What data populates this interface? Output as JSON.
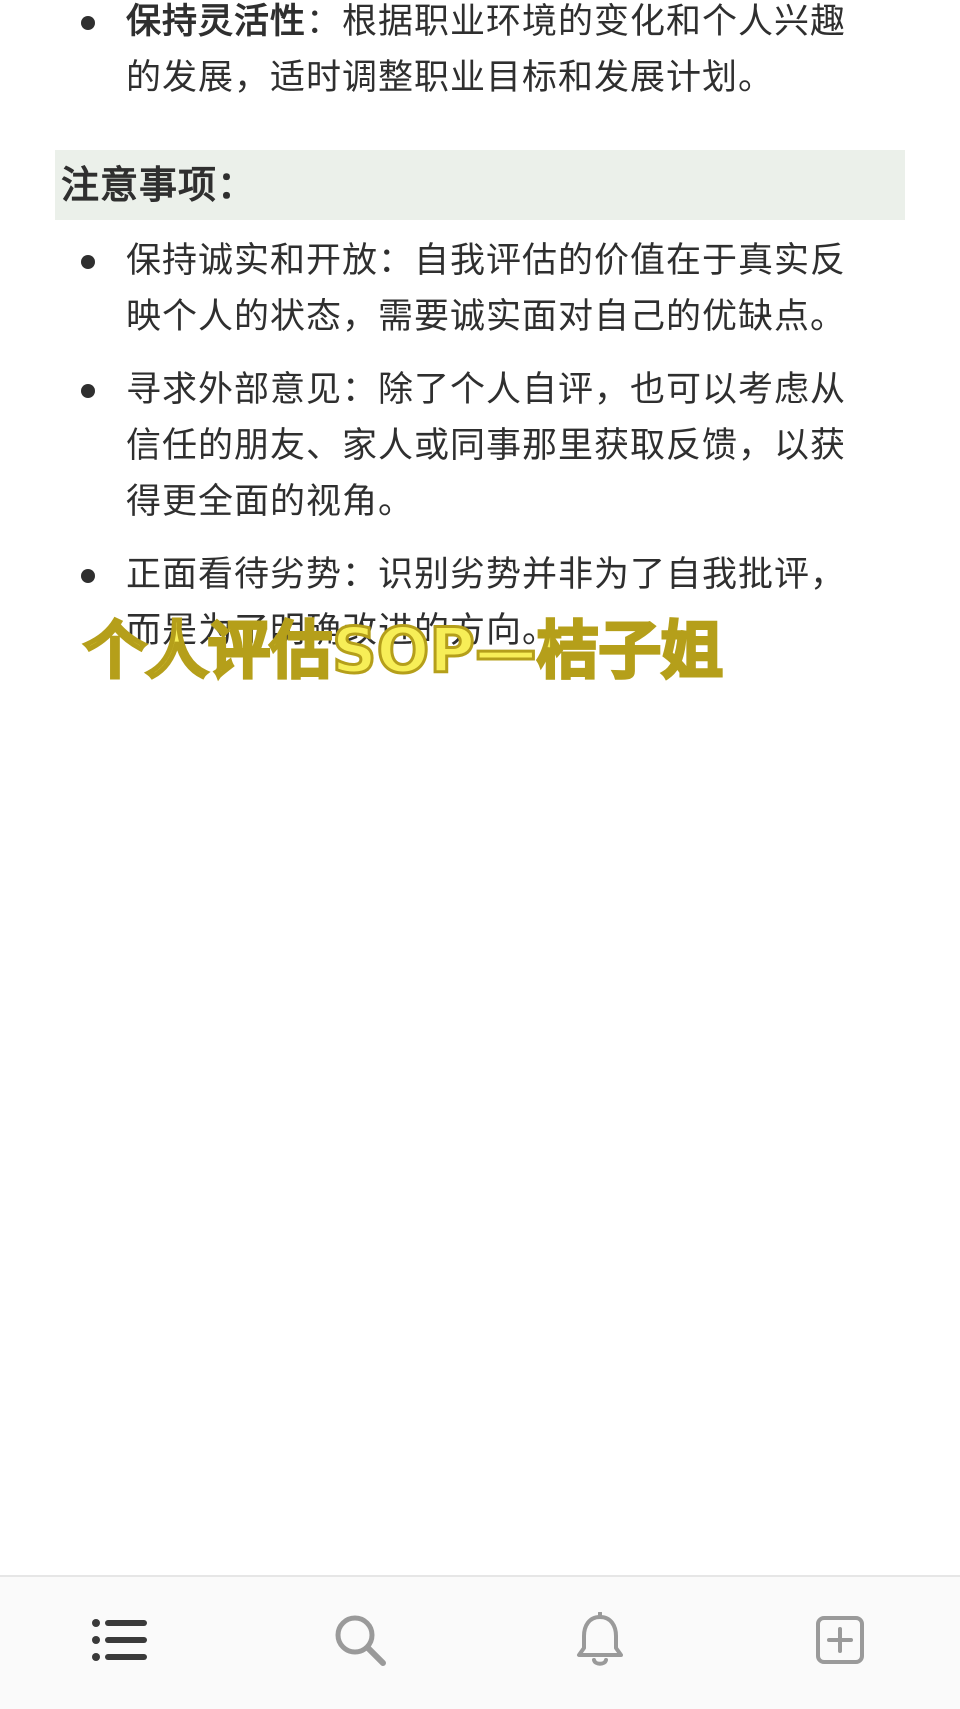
{
  "content": {
    "flexibility": {
      "term": "保持灵活性",
      "colon": "：",
      "line1_rest": "根据职业环境的变化和个人兴趣",
      "line2": "的发展，适时调整职业目标和发展计划。"
    },
    "section_title": "注意事项：",
    "items": [
      {
        "line1": "保持诚实和开放：自我评估的价值在于真实反",
        "line2": "映个人的状态，需要诚实面对自己的优缺点。"
      },
      {
        "line1": "寻求外部意见：除了个人自评，也可以考虑从",
        "line2": "信任的朋友、家人或同事那里获取反馈，以获",
        "line3": "得更全面的视角。"
      },
      {
        "line1": "正面看待劣势：识别劣势并非为了自我批评，",
        "line2": "而是为了明确改进的方向。"
      }
    ]
  },
  "watermark": {
    "text": "个人评估SOP—桔子姐"
  },
  "bottom_nav": {
    "items": [
      {
        "icon": "list-icon"
      },
      {
        "icon": "search-icon"
      },
      {
        "icon": "bell-icon"
      },
      {
        "icon": "add-square-icon"
      }
    ]
  },
  "colors": {
    "heading_background": "#ebf0ea",
    "text": "#2f2f2f",
    "watermark_fill": "#f7ee57",
    "watermark_stroke": "#b59f1a",
    "nav_icon": "#3a3a3a",
    "nav_icon_inactive": "#9a9a9a"
  }
}
